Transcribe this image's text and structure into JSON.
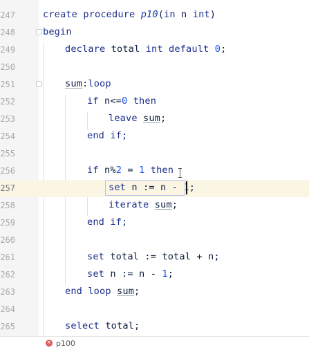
{
  "editor": {
    "lines": [
      {
        "num": "247",
        "text": "create procedure p10(in n int)"
      },
      {
        "num": "248",
        "text": "begin"
      },
      {
        "num": "249",
        "text": "declare total int default 0;"
      },
      {
        "num": "250",
        "text": ""
      },
      {
        "num": "251",
        "text": "sum:loop"
      },
      {
        "num": "252",
        "text": "if n<=0 then"
      },
      {
        "num": "253",
        "text": "leave sum;"
      },
      {
        "num": "254",
        "text": "end if;"
      },
      {
        "num": "255",
        "text": ""
      },
      {
        "num": "256",
        "text": "if n%2 = 1 then"
      },
      {
        "num": "257",
        "text": "set n := n - 1;"
      },
      {
        "num": "258",
        "text": "iterate sum;"
      },
      {
        "num": "259",
        "text": "end if;"
      },
      {
        "num": "260",
        "text": ""
      },
      {
        "num": "261",
        "text": "set total := total + n;"
      },
      {
        "num": "262",
        "text": "set n := n - 1;"
      },
      {
        "num": "263",
        "text": "end loop sum;"
      },
      {
        "num": "264",
        "text": ""
      },
      {
        "num": "265",
        "text": "select total;"
      }
    ],
    "current_line": "257"
  },
  "footer": {
    "badge": "R",
    "label": "p100"
  }
}
